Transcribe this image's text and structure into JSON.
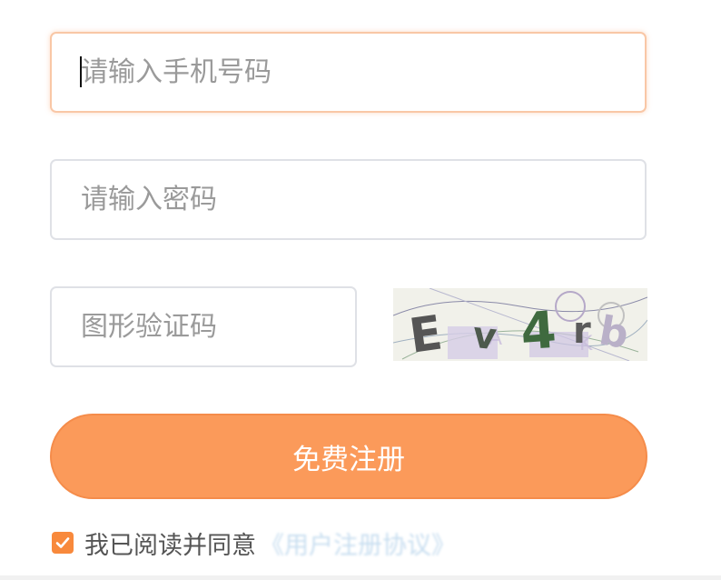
{
  "form": {
    "phone_placeholder": "请输入手机号码",
    "password_placeholder": "请输入密码",
    "captcha_placeholder": "图形验证码",
    "captcha_image_text": "Ev4rb",
    "submit_label": "免费注册",
    "agree_text": "我已阅读并同意",
    "agreement_link": "《用户注册协议》",
    "agree_checked": true
  },
  "colors": {
    "accent": "#fb9a5a",
    "checkbox": "#f8893c",
    "focus_border": "#f9c7a6",
    "field_border": "#dfe1e6"
  }
}
